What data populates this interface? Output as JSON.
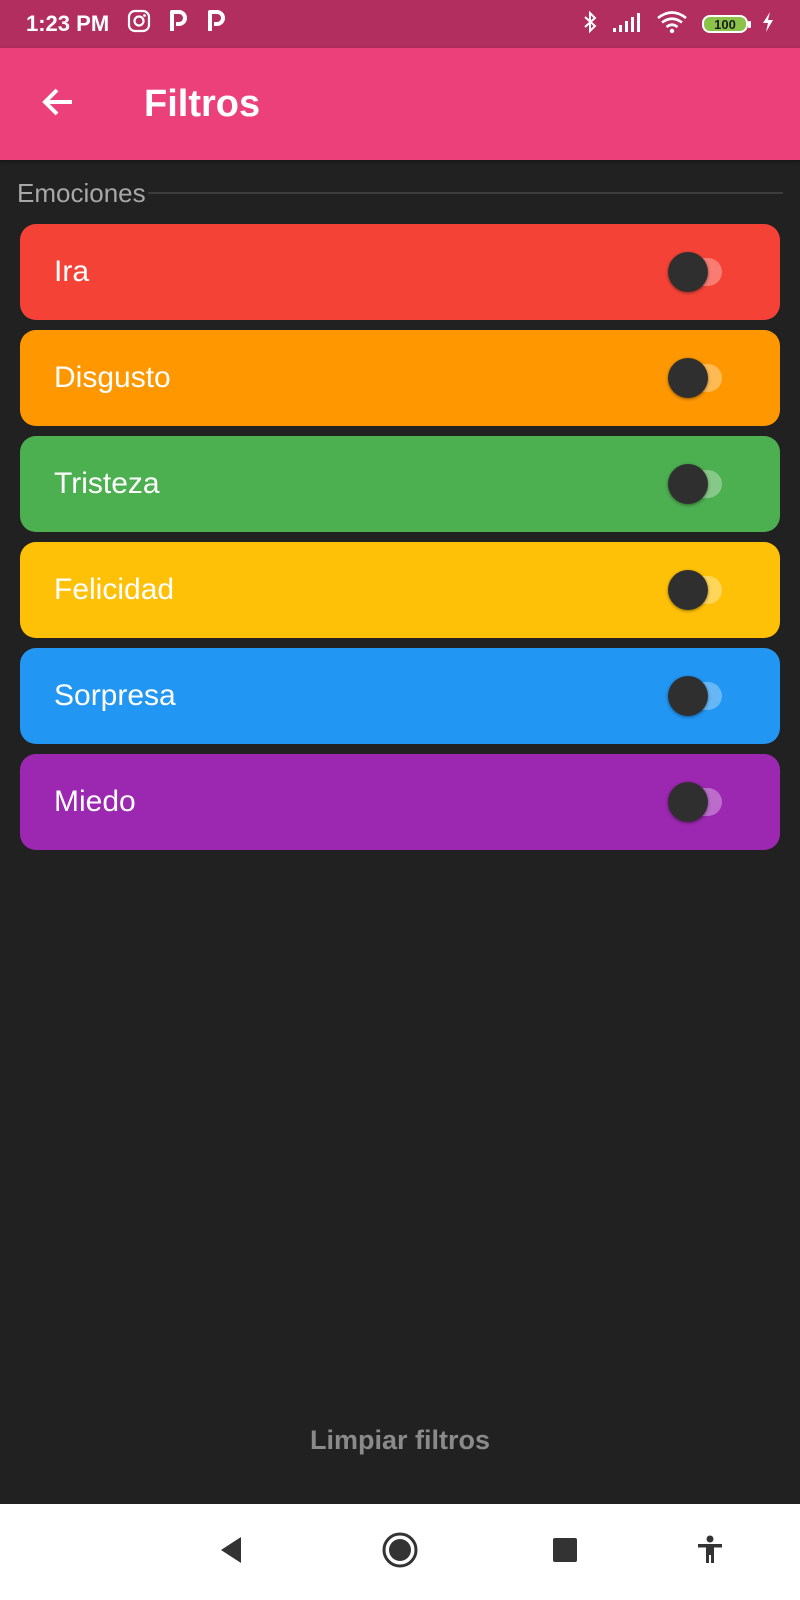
{
  "status_bar": {
    "time": "1:23 PM",
    "battery": "100",
    "icons": [
      "instagram-icon",
      "p-app-icon",
      "p-app-icon",
      "bluetooth-icon",
      "signal-icon",
      "wifi-icon",
      "battery-icon",
      "charging-icon"
    ]
  },
  "app_bar": {
    "title": "Filtros",
    "back_icon": "arrow-back-icon"
  },
  "section": {
    "title": "Emociones"
  },
  "emotions": [
    {
      "label": "Ira",
      "color": "#f44336",
      "track": "#f97c73",
      "enabled": false
    },
    {
      "label": "Disgusto",
      "color": "#ff9800",
      "track": "#ffba53",
      "enabled": false
    },
    {
      "label": "Tristeza",
      "color": "#4caf50",
      "track": "#86c888",
      "enabled": false
    },
    {
      "label": "Felicidad",
      "color": "#ffc107",
      "track": "#ffd55a",
      "enabled": false
    },
    {
      "label": "Sorpresa",
      "color": "#2196f3",
      "track": "#66b7f6",
      "enabled": false
    },
    {
      "label": "Miedo",
      "color": "#9c27b0",
      "track": "#bc6ccb",
      "enabled": false
    }
  ],
  "actions": {
    "clear_label": "Limpiar filtros"
  },
  "colors": {
    "status_bar": "#b12e5e",
    "app_bar": "#ec407a",
    "background": "#212121",
    "thumb": "#2f2f2f"
  },
  "nav_bar": {
    "icons": [
      "back-triangle-icon",
      "home-circle-icon",
      "recents-square-icon",
      "accessibility-icon"
    ]
  }
}
